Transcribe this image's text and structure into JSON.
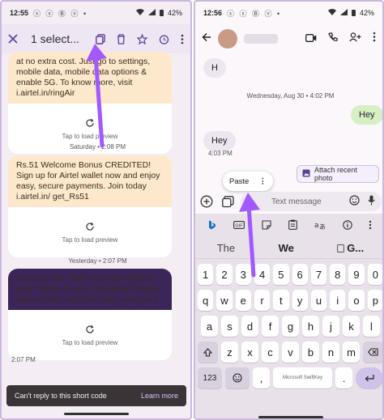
{
  "left": {
    "status": {
      "time": "12:55",
      "apps": "ⓢ ⓢ Ⓑ ⓥ •",
      "battery": "42%"
    },
    "topbar": {
      "selected": "1 select..."
    },
    "messages": [
      {
        "text": "at no extra cost. Just go to settings, mobile data, mobile data options & enable 5G. To know more, visit i.airtel.in/ringAir",
        "preview": "Tap to load preview"
      },
      {
        "text": "Rs.51 Welcome Bonus CREDITED! Sign up for Airtel wallet now and enjoy easy, secure payments. Join today i.airtel.in/ get_Rs51",
        "preview": "Tap to load preview"
      },
      {
        "text": "Get up to Rs. 300! Just refer Airtel to your friends & earn. Visit Airtel Thanks App to refer i.airtel.in/ refer_and_earn",
        "preview": "Tap to load preview"
      }
    ],
    "separators": [
      "Saturday • 2:08 PM",
      "Yesterday • 2:07 PM"
    ],
    "time_after_last": "2:07 PM",
    "snackbar": {
      "text": "Can't reply to this short code",
      "action": "Learn more"
    }
  },
  "right": {
    "status": {
      "time": "12:56",
      "apps": "ⓢ ⓢ Ⓑ ⓥ •",
      "battery": "42%"
    },
    "chat": {
      "bubble_h": "H",
      "date_sep": "Wednesday, Aug 30 • 4:02 PM",
      "bubble_hey_sent": "Hey",
      "bubble_hey_recv": "Hey",
      "time_recv": "4:03 PM"
    },
    "attach_label": "Attach recent photo",
    "paste_label": "Paste",
    "placeholder": "Text message",
    "suggestions": [
      "The",
      "We",
      "G..."
    ],
    "keyboard": {
      "row_numbers": [
        "1",
        "2",
        "3",
        "4",
        "5",
        "6",
        "7",
        "8",
        "9",
        "0"
      ],
      "row1": [
        "q",
        "w",
        "e",
        "r",
        "t",
        "y",
        "u",
        "i",
        "o",
        "p"
      ],
      "row2": [
        "a",
        "s",
        "d",
        "f",
        "g",
        "h",
        "j",
        "k",
        "l"
      ],
      "row3": [
        "z",
        "x",
        "c",
        "v",
        "b",
        "n",
        "m"
      ],
      "space_label": "Microsoft SwiftKey",
      "mode_key": "123",
      "comma": ",",
      "period": "."
    }
  },
  "colors": {
    "accent": "#5c3f9c",
    "arrow": "#a259ff",
    "cream": "#fde8cc",
    "purple_card": "#3c2558"
  }
}
